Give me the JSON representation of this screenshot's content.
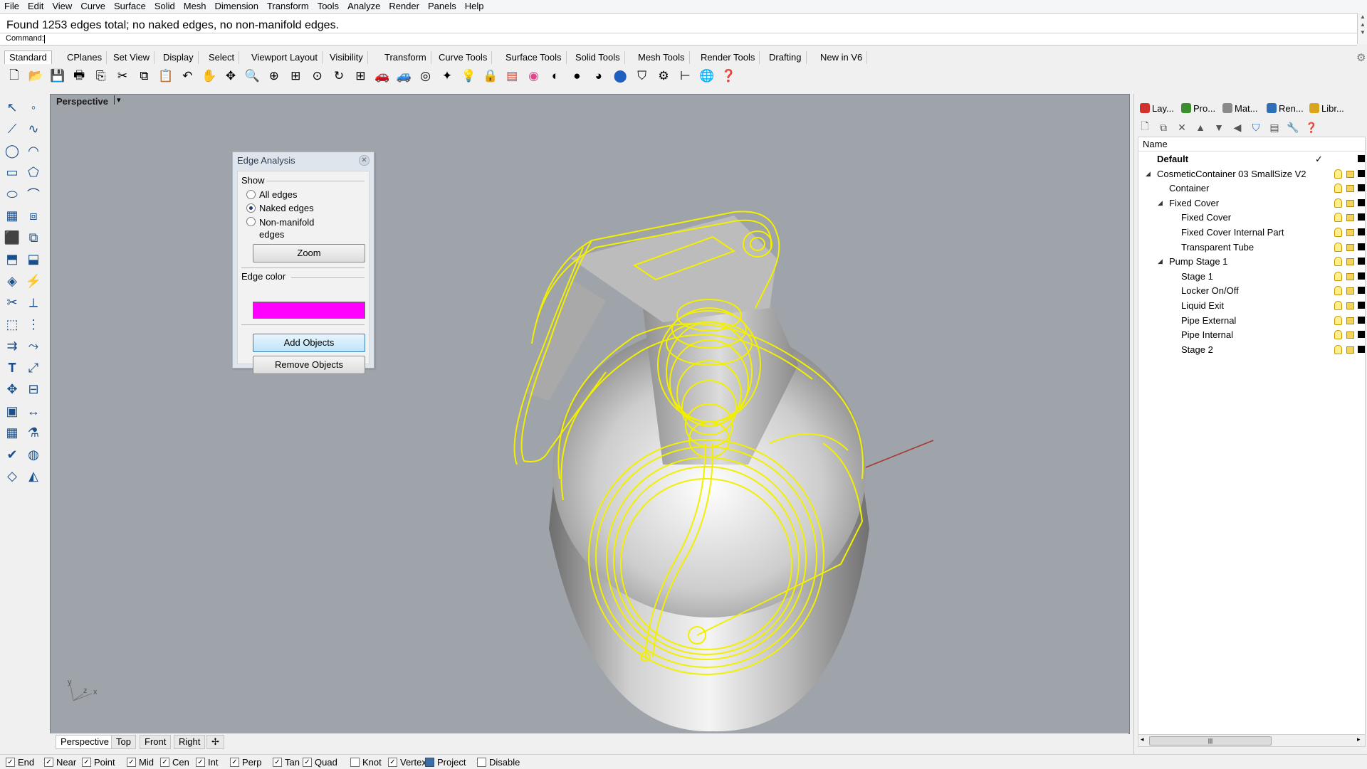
{
  "menu": [
    "File",
    "Edit",
    "View",
    "Curve",
    "Surface",
    "Solid",
    "Mesh",
    "Dimension",
    "Transform",
    "Tools",
    "Analyze",
    "Render",
    "Panels",
    "Help"
  ],
  "command": {
    "history": "Found 1253 edges total; no naked edges, no non-manifold edges.",
    "prompt_label": "Command:"
  },
  "toolbar_tabs": [
    "Standard",
    "CPlanes",
    "Set View",
    "Display",
    "Select",
    "Viewport Layout",
    "Visibility",
    "Transform",
    "Curve Tools",
    "Surface Tools",
    "Solid Tools",
    "Mesh Tools",
    "Render Tools",
    "Drafting",
    "New in V6"
  ],
  "viewport": {
    "title": "Perspective",
    "tabs": [
      "Perspective",
      "Top",
      "Front",
      "Right"
    ],
    "axes": {
      "x": "x",
      "y": "y",
      "z": "z"
    }
  },
  "edge_dialog": {
    "title": "Edge Analysis",
    "show_label": "Show",
    "options": [
      "All edges",
      "Naked edges",
      "Non-manifold\nedges"
    ],
    "selected_option": "Naked edges",
    "zoom_label": "Zoom",
    "edge_color_label": "Edge color",
    "edge_color": "#ff00ff",
    "add_label": "Add Objects",
    "remove_label": "Remove Objects"
  },
  "panel_tabs": [
    "Lay...",
    "Pro...",
    "Mat...",
    "Ren...",
    "Libr..."
  ],
  "layers": {
    "header": "Name",
    "rows": [
      {
        "name": "Default",
        "level": 0,
        "expander": "",
        "current": true
      },
      {
        "name": "CosmeticContainer 03 SmallSize V2",
        "level": 0,
        "expander": "◢"
      },
      {
        "name": "Container",
        "level": 1,
        "expander": ""
      },
      {
        "name": "Fixed Cover",
        "level": 1,
        "expander": "◢"
      },
      {
        "name": "Fixed Cover",
        "level": 2,
        "expander": ""
      },
      {
        "name": "Fixed Cover Internal Part",
        "level": 2,
        "expander": ""
      },
      {
        "name": "Transparent Tube",
        "level": 2,
        "expander": ""
      },
      {
        "name": "Pump Stage 1",
        "level": 1,
        "expander": "◢"
      },
      {
        "name": "Stage 1",
        "level": 2,
        "expander": ""
      },
      {
        "name": "Locker On/Off",
        "level": 2,
        "expander": ""
      },
      {
        "name": "Liquid Exit",
        "level": 2,
        "expander": ""
      },
      {
        "name": "Pipe External",
        "level": 2,
        "expander": ""
      },
      {
        "name": "Pipe Internal",
        "level": 2,
        "expander": ""
      },
      {
        "name": "Stage 2",
        "level": 2,
        "expander": ""
      }
    ]
  },
  "osnaps": [
    {
      "label": "End",
      "checked": true
    },
    {
      "label": "Near",
      "checked": true
    },
    {
      "label": "Point",
      "checked": true
    },
    {
      "label": "Mid",
      "checked": true
    },
    {
      "label": "Cen",
      "checked": true
    },
    {
      "label": "Int",
      "checked": true
    },
    {
      "label": "Perp",
      "checked": true
    },
    {
      "label": "Tan",
      "checked": true
    },
    {
      "label": "Quad",
      "checked": true
    },
    {
      "label": "Knot",
      "checked": false
    },
    {
      "label": "Vertex",
      "checked": true
    },
    {
      "label": "Project",
      "checked": false
    },
    {
      "label": "Disable",
      "checked": false
    }
  ],
  "colors": {
    "edge_highlight": "#f2f000",
    "viewport_bg": "#9fa3aa",
    "axis_line": "#a23a3a"
  }
}
